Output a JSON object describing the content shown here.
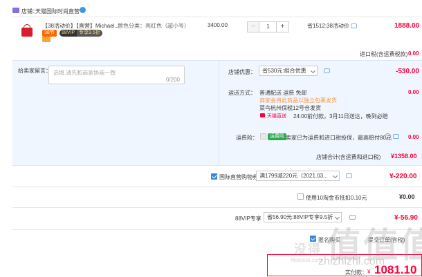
{
  "shop": {
    "label": "店铺：",
    "name": "天猫国际时尚直营"
  },
  "item": {
    "title": "【38活动价】【直营】Michael...",
    "badge_38": "38节",
    "badge_vip": "88VIP",
    "badge_vip_discount": "专享9.5折",
    "spec": "颜色分类：亮红色（超小号）",
    "unit_price": "3400.00",
    "qty_minus": "−",
    "qty": "1",
    "qty_plus": "+",
    "discount_note": "省1512:38活动价",
    "total": "1888.00",
    "import_tax": "进口税(含运费税款)",
    "import_tax_value": "0.00"
  },
  "message": {
    "label": "给卖家留言：",
    "placeholder": "选填,请先和商家协商一致",
    "counter": "0/200"
  },
  "shop_discount": {
    "label": "店铺优惠：",
    "select": "省530元:组合优惠",
    "value": "-530.00"
  },
  "shipping": {
    "label": "运送方式：",
    "mode": "普通配送 运费 免邮",
    "note": "商家会将此商品以独立包裹发货",
    "origin_prefix": "",
    "origin": "菜鸟杭州保税12号仓",
    "origin_suffix": "发货",
    "express": "天猫直送",
    "eta": "24:00前付款，3月11日送达，晚到必赔",
    "value": "0.00"
  },
  "insurance": {
    "label": "运费险：",
    "tag": "运费险",
    "text": "卖家已为运费和进口税投保，最高赔付80元",
    "value": "0.00"
  },
  "shop_total": {
    "label": "店铺合计(含运费和进口税)",
    "value": "¥1358.00"
  },
  "coupon": {
    "label": "国际直营购物券",
    "select": "满1799减220元（2021.03...",
    "value": "¥-220.00"
  },
  "taojinbi": {
    "label": "使用10淘金币抵扣0.10元",
    "value": "¥0.00"
  },
  "vip": {
    "label": "88VIP专享",
    "select": "省56.90元:88VIP专享9.5折",
    "value": "¥-56.90"
  },
  "extra": {
    "label": "匿名购买",
    "label2": "提交订单(含税)"
  },
  "pay": {
    "label": "实付款：",
    "currency": "¥",
    "amount": "1081.10"
  },
  "watermark": {
    "text": "zhizhizhi.com",
    "sub": "Maldeal.com",
    "brand": "值值值",
    "brand2": "没得"
  },
  "colors": {
    "price_red": "#ff0036",
    "accent_blue": "#3b87e0",
    "panel_bg": "#f0f6ff"
  }
}
